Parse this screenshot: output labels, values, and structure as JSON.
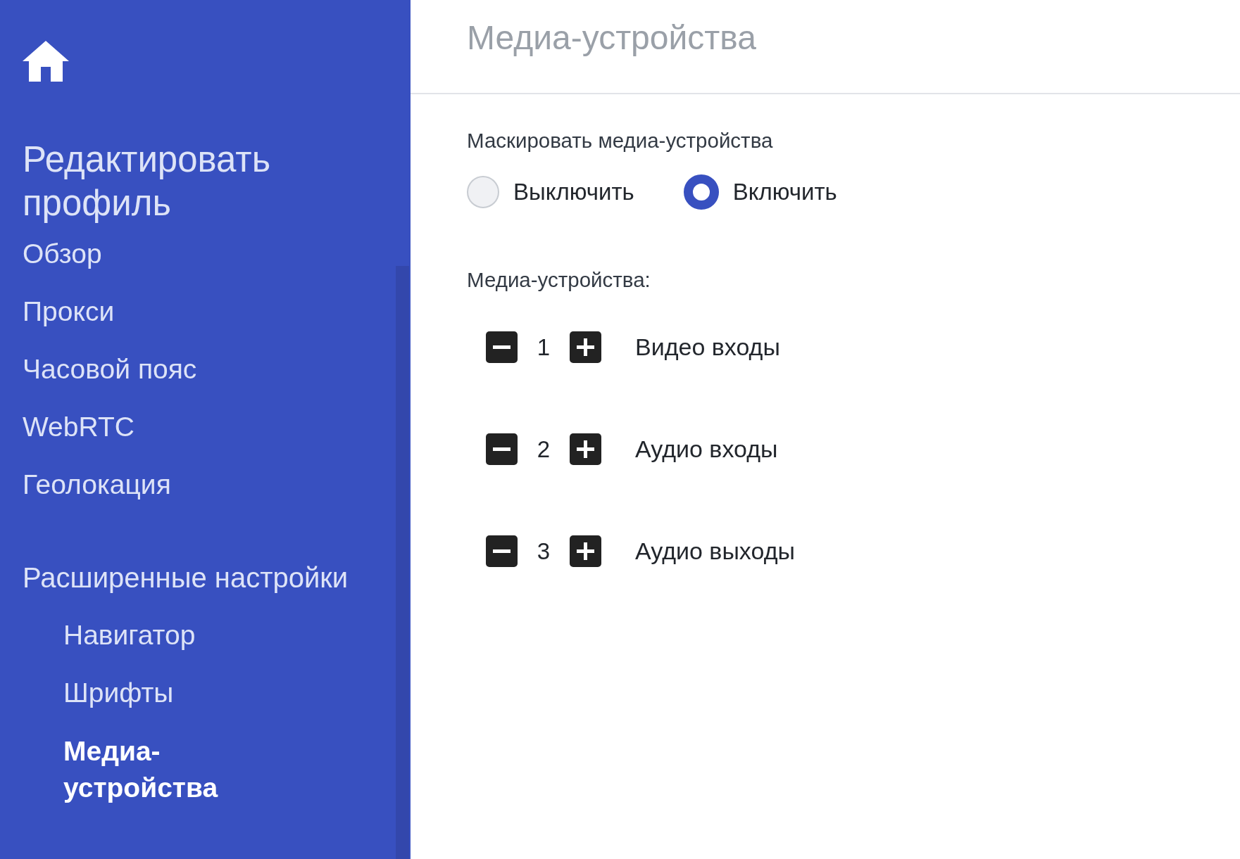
{
  "sidebar": {
    "title": "Редактировать профиль",
    "items": [
      {
        "label": "Обзор",
        "selected": false
      },
      {
        "label": "Прокси",
        "selected": false
      },
      {
        "label": "Часовой пояс",
        "selected": false
      },
      {
        "label": "WebRTC",
        "selected": false
      },
      {
        "label": "Геолокация",
        "selected": false
      }
    ],
    "section": {
      "label": "Расширенные настройки",
      "children": [
        {
          "label": "Навигатор",
          "selected": false
        },
        {
          "label": "Шрифты",
          "selected": false
        },
        {
          "label": "Медиа-устройства",
          "selected": true
        }
      ]
    }
  },
  "header": {
    "title": "Медиа-устройства"
  },
  "mask": {
    "label": "Маскировать медиа-устройства",
    "options": [
      {
        "label": "Выключить",
        "selected": false
      },
      {
        "label": "Включить",
        "selected": true
      }
    ]
  },
  "devices": {
    "label": "Медиа-устройства:",
    "rows": [
      {
        "count": "1",
        "name": "Видео входы"
      },
      {
        "count": "2",
        "name": "Аудио входы"
      },
      {
        "count": "3",
        "name": "Аудио выходы"
      }
    ]
  }
}
